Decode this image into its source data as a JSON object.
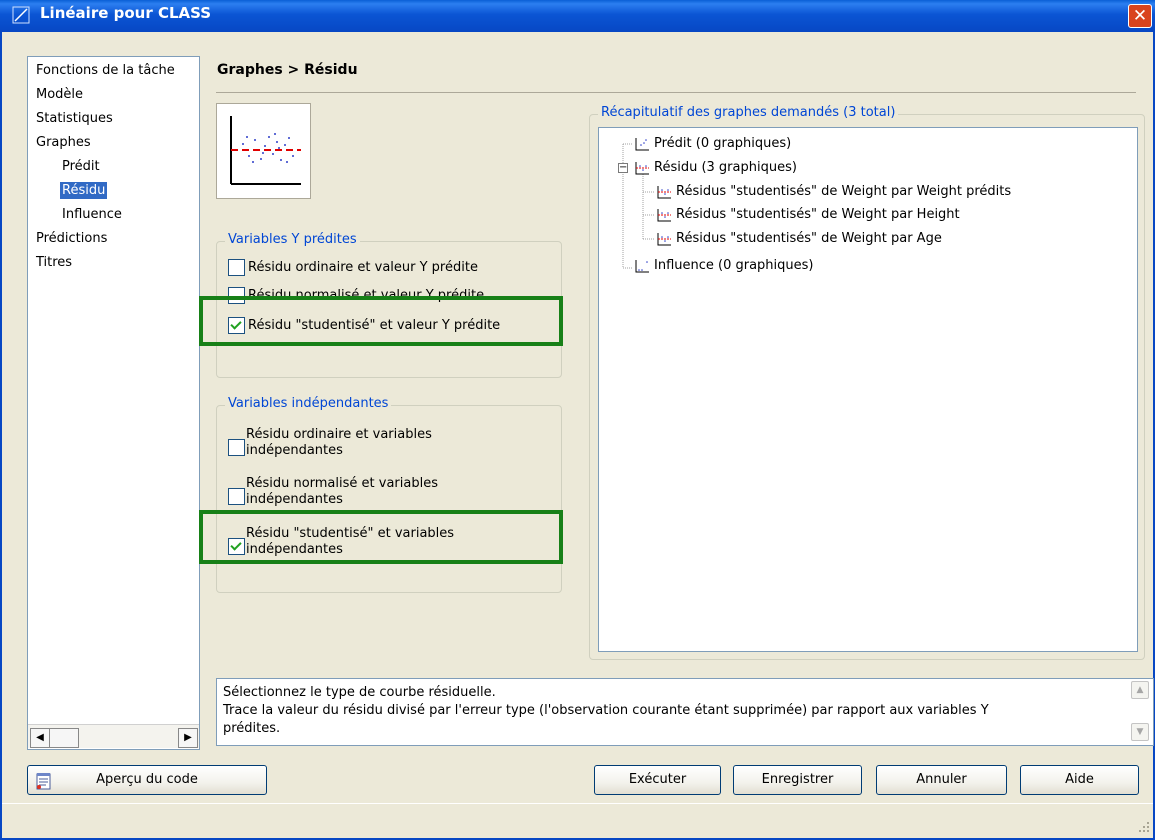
{
  "window": {
    "title": "Linéaire pour CLASS",
    "close_label": "✕"
  },
  "nav": {
    "items": [
      {
        "label": "Fonctions de la tâche",
        "indent": 0,
        "selected": false
      },
      {
        "label": "Modèle",
        "indent": 0,
        "selected": false
      },
      {
        "label": "Statistiques",
        "indent": 0,
        "selected": false
      },
      {
        "label": "Graphes",
        "indent": 0,
        "selected": false
      },
      {
        "label": "Prédit",
        "indent": 1,
        "selected": false
      },
      {
        "label": "Résidu",
        "indent": 1,
        "selected": true
      },
      {
        "label": "Influence",
        "indent": 1,
        "selected": false
      },
      {
        "label": "Prédictions",
        "indent": 0,
        "selected": false
      },
      {
        "label": "Titres",
        "indent": 0,
        "selected": false
      }
    ]
  },
  "main": {
    "heading": "Graphes > Résidu",
    "group_y": {
      "label": "Variables Y prédites",
      "options": [
        {
          "label": "Résidu ordinaire et valeur Y prédite",
          "checked": false
        },
        {
          "label": "Résidu normalisé et valeur Y prédite",
          "checked": false
        },
        {
          "label": "Résidu \"studentisé\" et valeur Y prédite",
          "checked": true
        }
      ]
    },
    "group_x": {
      "label": "Variables indépendantes",
      "options": [
        {
          "line1": "Résidu ordinaire et variables",
          "line2": "indépendantes",
          "checked": false
        },
        {
          "line1": "Résidu normalisé et variables",
          "line2": "indépendantes",
          "checked": false
        },
        {
          "line1": "Résidu \"studentisé\" et variables",
          "line2": "indépendantes",
          "checked": true
        }
      ]
    }
  },
  "summary": {
    "label": "Récapitulatif des graphes demandés (3 total)",
    "tree": [
      {
        "label": "Prédit (0 graphiques)",
        "level": 0,
        "icon": "predicted-plot-icon"
      },
      {
        "label": "Résidu (3 graphiques)",
        "level": 0,
        "icon": "residual-plot-icon",
        "expander": "⊟"
      },
      {
        "label": "Résidus \"studentisés\" de Weight par Weight prédits",
        "level": 1,
        "icon": "residual-plot-icon"
      },
      {
        "label": "Résidus \"studentisés\" de Weight par Height",
        "level": 1,
        "icon": "residual-plot-icon"
      },
      {
        "label": "Résidus \"studentisés\" de Weight par Age",
        "level": 1,
        "icon": "residual-plot-icon"
      },
      {
        "label": "Influence (0 graphiques)",
        "level": 0,
        "icon": "influence-plot-icon"
      }
    ]
  },
  "description": {
    "line1": "Sélectionnez le type de courbe résiduelle.",
    "line2": "Trace la valeur du résidu divisé par l'erreur type (l'observation courante étant supprimée) par rapport aux variables Y",
    "line3": "prédites."
  },
  "buttons": {
    "preview_code": "Aperçu du code",
    "run": "Exécuter",
    "save": "Enregistrer",
    "cancel": "Annuler",
    "help": "Aide"
  },
  "colors": {
    "titlebar": "#0A5FD6",
    "highlight_box": "#178017",
    "selection": "#316AC5",
    "group_label": "#0046D5"
  }
}
